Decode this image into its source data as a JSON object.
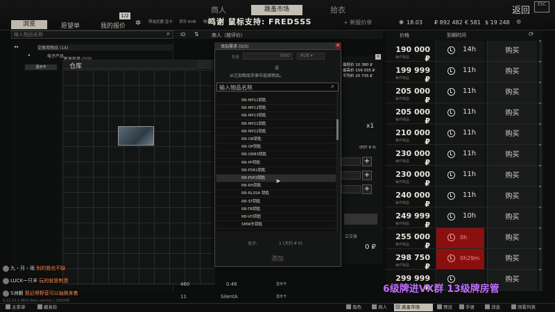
{
  "topnav": {
    "trader": "商人",
    "flea_market": "跳蚤市场",
    "handbook": "拾衣",
    "return": "返回",
    "escape_icon": "ESC"
  },
  "top_badge": "1/2",
  "subtabs": {
    "browse": "浏览",
    "wishlist": "愿望单",
    "my_offers": "我的报价"
  },
  "filters": [
    "筛选武器 显卡",
    "货币 RUB",
    "物品",
    "商人"
  ],
  "stream_credit": "鸣谢 鼠标支持: FREDSSS",
  "add_offer": "+ 新报价单",
  "currency": {
    "level": "18.03",
    "rub": "₽ 892 482",
    "eur": "€ 581",
    "usd": "$ 19 248"
  },
  "left": {
    "search_placeholder": "输入物品名称",
    "categories": [
      "交换用物品 (14)",
      "电子产品",
      "新发布单 (2/2)",
      "显示卡 (14)"
    ],
    "selected": "显示卡"
  },
  "stash": {
    "title": "仓库"
  },
  "list_head": {
    "id": "ID",
    "trader_col": "商人（按评价）",
    "level_first": "L"
  },
  "offers_head": {
    "price": "价格",
    "expire": "到期时间"
  },
  "offers": [
    {
      "price": "190 000 ₽",
      "sub": "每件物品",
      "time": "14h",
      "buy": "购买",
      "red": false
    },
    {
      "price": "199 999 ₽",
      "sub": "每件物品",
      "time": "11h",
      "buy": "购买",
      "red": false
    },
    {
      "price": "205 000 ₽",
      "sub": "每件物品",
      "time": "11h",
      "buy": "购买",
      "red": false
    },
    {
      "price": "205 000 ₽",
      "sub": "每件物品",
      "time": "11h",
      "buy": "购买",
      "red": false
    },
    {
      "price": "210 000 ₽",
      "sub": "每件物品",
      "time": "11h",
      "buy": "购买",
      "red": false
    },
    {
      "price": "230 000 ₽",
      "sub": "每件物品",
      "time": "11h",
      "buy": "购买",
      "red": false
    },
    {
      "price": "230 000 ₽",
      "sub": "每件物品",
      "time": "11h",
      "buy": "购买",
      "red": false
    },
    {
      "price": "240 000 ₽",
      "sub": "每件物品",
      "time": "11h",
      "buy": "购买",
      "red": false
    },
    {
      "price": "249 999 ₽",
      "sub": "每件物品",
      "time": "10h",
      "buy": "购买",
      "red": false
    },
    {
      "price": "255 000 ₽",
      "sub": "每件物品",
      "time": "0h",
      "buy": "购买",
      "red": true
    },
    {
      "price": "298 750 ₽",
      "sub": "每件物品",
      "time": "0h29m",
      "buy": "购买",
      "red": true
    },
    {
      "price": "299 999 ₽",
      "sub": "每件物品",
      "time": "",
      "buy": "购买",
      "red": false
    }
  ],
  "detail": {
    "stat1": "最低价 10 380 ₽",
    "stat2": "最高价 159 035 ₽",
    "stat3": "平均价 20 735 ₽",
    "qty_x": "x1",
    "est": "(EST. ₽ 0)",
    "deal": "立交易",
    "rub_total": "0 ₽"
  },
  "dialog": {
    "title": "添加需求 (0/3)",
    "close": "×",
    "qty_label": "数量",
    "qty_value": "3000",
    "currency": "RUB",
    "or": "或",
    "choose": "从已加物品手册中选择物品。",
    "search_text": "输入物品名称",
    "items": [
      "RB-MP11钥匙",
      "RB-MP12钥匙",
      "RB-MP13钥匙",
      "RB-MP21钥匙",
      "RB-MP22钥匙",
      "RB-OB钥匙",
      "RB-OP钥匙",
      "RB-ORB3钥匙",
      "RB-PP钥匙",
      "RB-PSR1钥匙",
      "RB-PSP2钥匙",
      "RB-RH钥匙",
      "RB-RLSSA 钥匙",
      "RB-ST钥匙",
      "RB-TB钥匙",
      "RB-VO钥匙",
      "SMW车钥匙"
    ],
    "total_label": "总计:",
    "total_value": "1  (大约 ₽ 0)",
    "add_button": "添加"
  },
  "bottom_rows": [
    {
      "id": "460",
      "name": "0.46",
      "label": "显示卡"
    },
    {
      "id": "11",
      "name": "SilentA",
      "label": "显示卡"
    }
  ],
  "promo": "6级牌进VX群  13级牌房管",
  "chat": [
    {
      "name": "九・月・雨",
      "msg": "别的我也不缺"
    },
    {
      "name": "LUCK一只羊",
      "msg": "玩的就是刺激"
    },
    {
      "name": "S洲朝",
      "msg": "我记得野营可以抽换来着"
    }
  ],
  "version": "0.12.10.2.9820 Beta version | 2DE3DE",
  "taskbar": {
    "left": [
      "主菜单",
      "藏身处"
    ],
    "right": [
      "角色",
      "商人",
      "跳蚤市场",
      "预设",
      "手册",
      "消息",
      "观看列表"
    ]
  }
}
